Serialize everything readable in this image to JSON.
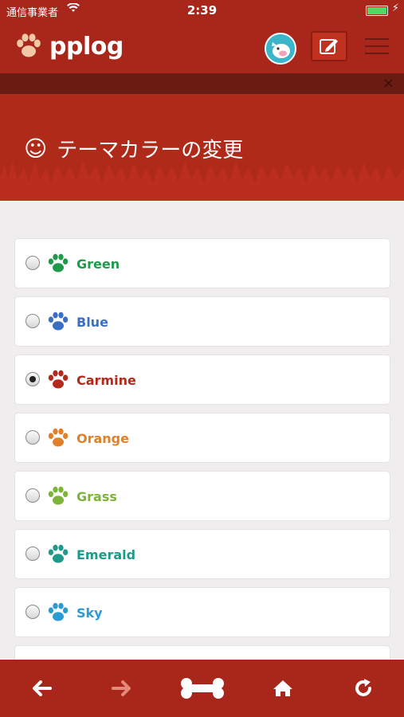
{
  "status_bar": {
    "carrier": "通信事業者",
    "time": "2:39"
  },
  "app": {
    "name": "pplog"
  },
  "page": {
    "title": "テーマカラーの変更"
  },
  "themes": [
    {
      "label": "Green",
      "color": "#1f9a4b",
      "selected": false
    },
    {
      "label": "Blue",
      "color": "#3b6fc4",
      "selected": false
    },
    {
      "label": "Carmine",
      "color": "#b3291a",
      "selected": true
    },
    {
      "label": "Orange",
      "color": "#e0802a",
      "selected": false
    },
    {
      "label": "Grass",
      "color": "#7db43a",
      "selected": false
    },
    {
      "label": "Emerald",
      "color": "#1e9a8a",
      "selected": false
    },
    {
      "label": "Sky",
      "color": "#2b9bd3",
      "selected": false
    }
  ],
  "colors": {
    "brand": "#a8271a",
    "background": "#efedee"
  },
  "icons": {
    "back": "arrow-left-icon",
    "forward": "arrow-right-icon",
    "home_bone": "bone-icon",
    "home": "home-icon",
    "reload": "reload-icon"
  }
}
